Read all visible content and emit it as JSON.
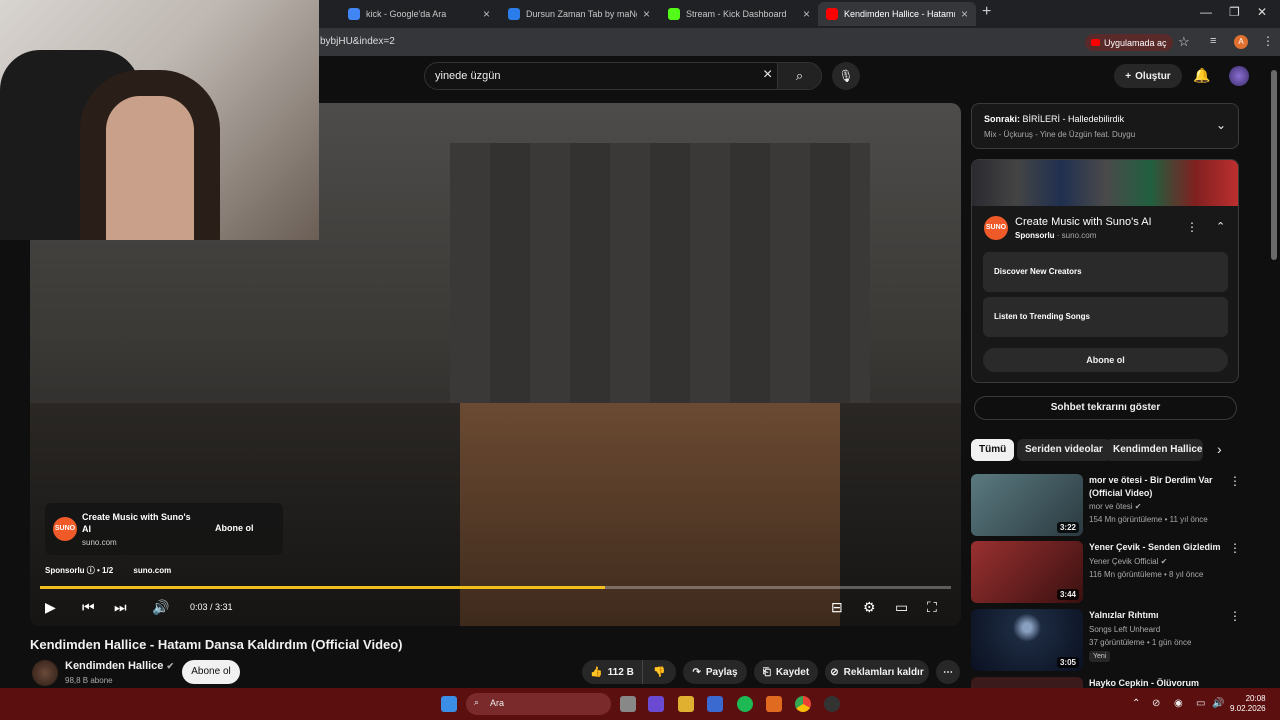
{
  "browser": {
    "tabs": [
      {
        "title": "kick - Google'da Ara",
        "fav_color": "#4285f4"
      },
      {
        "title": "Dursun Zaman Tab by maNga |",
        "fav_color": "#2b7de9"
      },
      {
        "title": "Stream - Kick Dashboard",
        "fav_color": "#53fc18"
      },
      {
        "title": "Kendimden Hallice - Hatamı",
        "fav_color": "#ff0000"
      }
    ],
    "url_fragment": "bybjHU&index=2",
    "open_in_app": "Uygulamada aç",
    "profile_letter": "A"
  },
  "youtube": {
    "search_query": "yinede üzgün",
    "create_label": "Oluştur"
  },
  "player": {
    "ad": {
      "logo_text": "SUNO",
      "title": "Create Music with Suno's AI",
      "domain": "suno.com",
      "subscribe": "Abone ol",
      "sponsor_label": "Sponsorlu",
      "sponsor_count": "• 1/2"
    },
    "progress_fraction": 0.62,
    "time": "0:03 / 3:31"
  },
  "video": {
    "title": "Kendimden Hallice - Hatamı Dansa Kaldırdım (Official Video)",
    "channel": "Kendimden Hallice",
    "subscribers": "98,8 B abone",
    "subscribe": "Abone ol",
    "likes": "112 B",
    "share": "Paylaş",
    "save": "Kaydet",
    "remove_ads": "Reklamları kaldır"
  },
  "sidebar": {
    "next_prefix": "Sonraki:",
    "next_title": "BİRİLERİ - Halledebilirdik",
    "next_sub": "Mix - Üçkuruş - Yine de Üzgün feat. Duygu",
    "ad": {
      "logo_text": "SUNO",
      "title": "Create Music with Suno's AI",
      "sponsored": "Sponsorlu",
      "domain": "suno.com",
      "row1": "Discover New Creators",
      "row2": "Listen to Trending Songs",
      "subscribe": "Abone ol"
    },
    "chat_replay": "Sohbet tekrarını göster",
    "chips": [
      "Tümü",
      "Seriden videolar",
      "Kendimden Hallice ad"
    ],
    "recs": [
      {
        "title": "mor ve ötesi - Bir Derdim Var (Official Video)",
        "channel": "mor ve ötesi ✔",
        "meta": "154 Mn görüntüleme • 11 yıl önce",
        "duration": "3:22",
        "color": "#3d5560"
      },
      {
        "title": "Yener Çevik - Senden Gizledim",
        "channel": "Yener Çevik Official ✔",
        "meta": "116 Mn görüntüleme • 8 yıl önce",
        "duration": "3:44",
        "color": "#7a2020"
      },
      {
        "title": "Yalnızlar Rıhtımı",
        "channel": "Songs Left Unheard",
        "meta": "37 görüntüleme • 1 gün önce",
        "duration": "3:05",
        "color": "#1c2a40",
        "badge": "Yeni"
      },
      {
        "title": "Hayko Cepkin - Ölüvorum",
        "channel": "",
        "meta": "",
        "duration": "",
        "color": "#3a1a1a"
      }
    ]
  },
  "taskbar": {
    "search": "Ara",
    "time": "20:08",
    "date": "9.02.2026"
  }
}
